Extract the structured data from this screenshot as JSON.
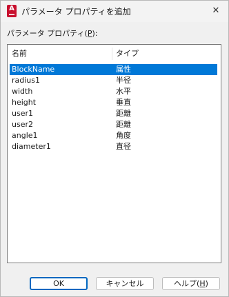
{
  "window": {
    "title": "パラメータ プロパティを追加",
    "close_glyph": "✕"
  },
  "list_label": {
    "prefix": "パラメータ プロパティ(",
    "mnemonic": "P",
    "suffix": "):"
  },
  "columns": {
    "name": "名前",
    "type": "タイプ"
  },
  "rows": [
    {
      "name": "BlockName",
      "type": "属性",
      "selected": true
    },
    {
      "name": "radius1",
      "type": "半径",
      "selected": false
    },
    {
      "name": "width",
      "type": "水平",
      "selected": false
    },
    {
      "name": "height",
      "type": "垂直",
      "selected": false
    },
    {
      "name": "user1",
      "type": "距離",
      "selected": false
    },
    {
      "name": "user2",
      "type": "距離",
      "selected": false
    },
    {
      "name": "angle1",
      "type": "角度",
      "selected": false
    },
    {
      "name": "diameter1",
      "type": "直径",
      "selected": false
    }
  ],
  "buttons": {
    "ok": "OK",
    "cancel": "キャンセル",
    "help_prefix": "ヘルプ(",
    "help_mnemonic": "H",
    "help_suffix": ")"
  },
  "colors": {
    "selection": "#0078d7",
    "app_icon": "#c8102e"
  },
  "icons": {
    "app": "autocad-app-icon",
    "close": "close-icon"
  },
  "app_icon_letter": "A"
}
